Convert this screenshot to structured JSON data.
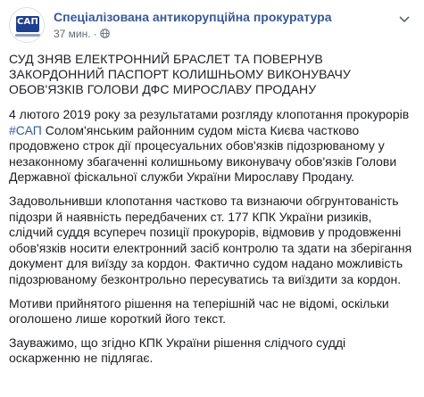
{
  "header": {
    "page_name": "Спеціалізована антикорупційна прокуратура",
    "avatar_text": "САП",
    "time": "37 мин.",
    "separator": "·",
    "privacy_icon": "globe-icon",
    "options_icon": "chevron-down-icon"
  },
  "post": {
    "title": "СУД ЗНЯВ ЕЛЕКТРОННИЙ БРАСЛЕТ ТА ПОВЕРНУВ ЗАКОРДОННИЙ ПАСПОРТ КОЛИШНЬОМУ ВИКОНУВАЧУ ОБОВ'ЯЗКІВ ГОЛОВИ ДФС МИРОСЛАВУ ПРОДАНУ",
    "p1_start": "4 лютого 2019 року за результатами розгляду клопотання прокурорів",
    "hashtag": "#САП",
    "p1_rest": "Солом'янським районним судом міста Києва частково продовжено строк дії процесуальних обов'язків підозрюваному у незаконному збагаченні колишньому виконувачу обов'язків Голови Державної фіскальної служби України Мирославу Продану.",
    "p2": "Задовольнивши клопотання частково та визнаючи обгрунтованість підозри й наявність передбачених ст. 177 КПК України ризиків, слідчий суддя всупереч позиції прокурорів, відмовив у продовженні обов'язків носити електронний засіб контролю та здати на зберігання документ для виїзду за кордон. Фактично судом надано можливість підозрюваному безконтрольно пересуватись та виїздити за кордон.",
    "p3": "Мотиви прийнятого рішення на теперішній час не відомі, оскільки оголошено лише короткий його текст.",
    "p4": "Зауважимо, що згідно КПК України рішення слідчого судді оскарженню не підлягає."
  },
  "colors": {
    "link": "#385898",
    "text": "#1c1e21",
    "meta": "#616770",
    "logo_blue": "#1f3f8f"
  }
}
